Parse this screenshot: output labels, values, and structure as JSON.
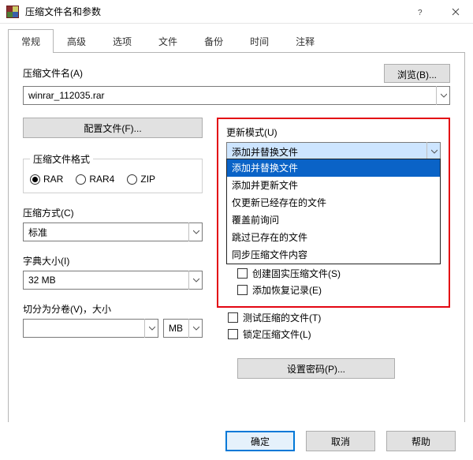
{
  "window": {
    "title": "压缩文件名和参数"
  },
  "tabs": [
    "常规",
    "高级",
    "选项",
    "文件",
    "备份",
    "时间",
    "注释"
  ],
  "labels": {
    "archive_name": "压缩文件名(A)",
    "browse": "浏览(B)...",
    "profiles": "配置文件(F)...",
    "format_group": "压缩文件格式",
    "method": "压缩方式(C)",
    "dict": "字典大小(I)",
    "split": "切分为分卷(V)，大小",
    "update_mode": "更新模式(U)",
    "set_password": "设置密码(P)...",
    "ok": "确定",
    "cancel": "取消",
    "help": "帮助"
  },
  "values": {
    "archive_name": "winrar_112035.rar",
    "method": "标准",
    "dict": "32 MB",
    "split_size": "",
    "split_unit": "MB",
    "update_mode_selected": "添加并替换文件"
  },
  "formats": {
    "rar": "RAR",
    "rar4": "RAR4",
    "zip": "ZIP"
  },
  "update_options": [
    "添加并替换文件",
    "添加并更新文件",
    "仅更新已经存在的文件",
    "覆盖前询问",
    "跳过已存在的文件",
    "同步压缩文件内容"
  ],
  "right_checks": [
    "创建固实压缩文件(S)",
    "添加恢复记录(E)",
    "测试压缩的文件(T)",
    "锁定压缩文件(L)"
  ]
}
